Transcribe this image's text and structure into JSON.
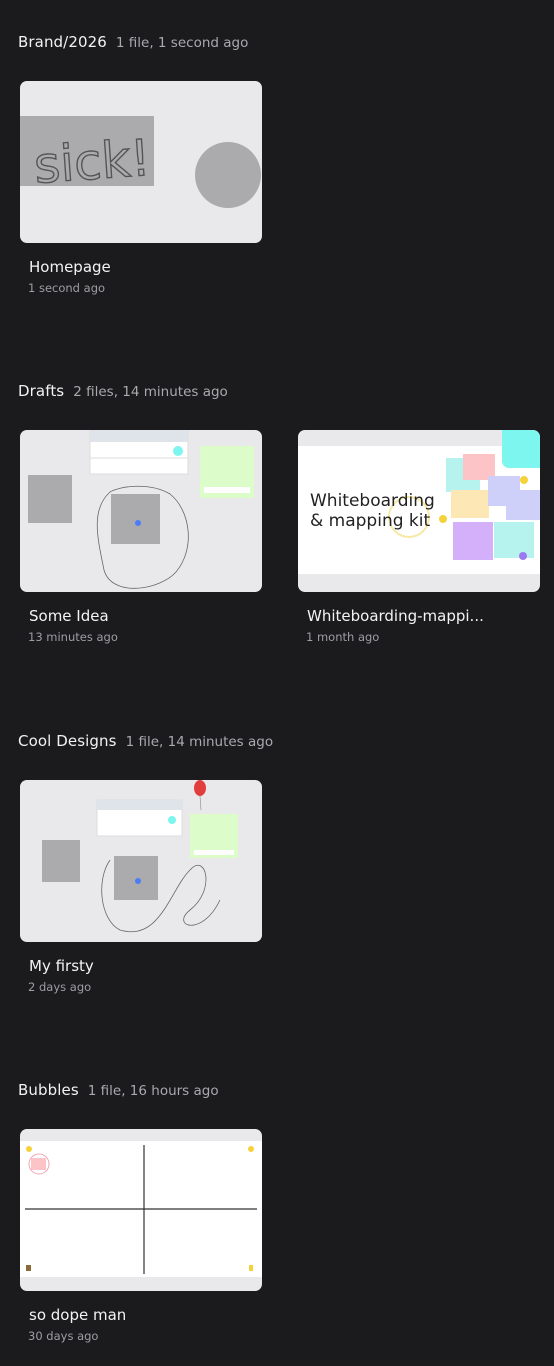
{
  "sections": [
    {
      "title": "Brand/2026",
      "meta": "1 file, 1 second ago",
      "files": [
        {
          "name": "Homepage",
          "time": "1 second ago",
          "thumb_text": "sick!"
        }
      ]
    },
    {
      "title": "Drafts",
      "meta": "2 files, 14 minutes ago",
      "files": [
        {
          "name": "Some Idea",
          "time": "13 minutes ago"
        },
        {
          "name": "Whiteboarding-mappi...",
          "time": "1 month ago",
          "thumb_title_1": "Whiteboarding",
          "thumb_title_2": "& mapping kit"
        }
      ]
    },
    {
      "title": "Cool Designs",
      "meta": "1 file, 14 minutes ago",
      "files": [
        {
          "name": "My firsty",
          "time": "2 days ago"
        }
      ]
    },
    {
      "title": "Bubbles",
      "meta": "1 file, 16 hours ago",
      "files": [
        {
          "name": "so dope man",
          "time": "30 days ago"
        }
      ]
    }
  ],
  "colors": {
    "background": "#1b1b1d",
    "thumb_bg": "#e9e9eb",
    "kit_badge": "#7cf6ee",
    "sticky_green": "#dcfcc9",
    "blue_dot": "#4a7df5"
  },
  "icons": {
    "kit_badge": "book-icon"
  }
}
